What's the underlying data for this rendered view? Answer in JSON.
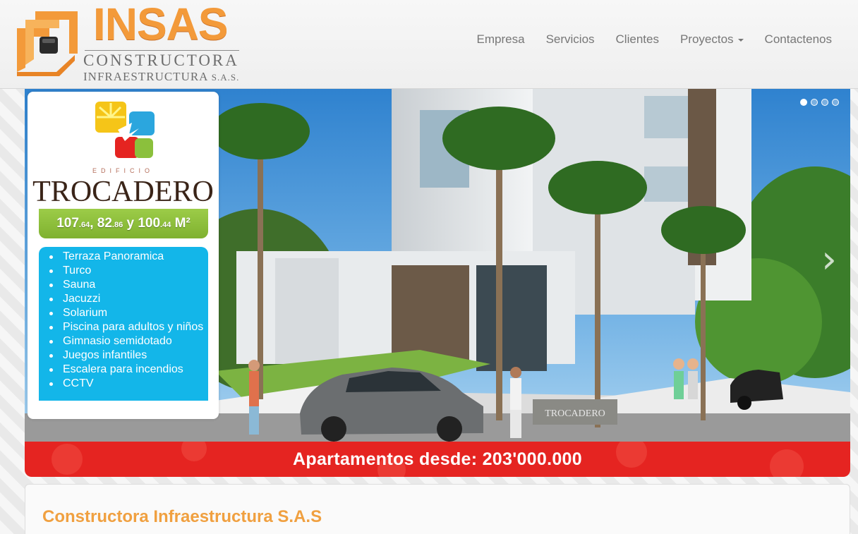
{
  "brand": {
    "name": "INSAS",
    "line1": "CONSTRUCTORA",
    "line2": "INFRAESTRUCTURA",
    "line2_suffix": "S.A.S."
  },
  "nav": {
    "items": [
      {
        "label": "Empresa"
      },
      {
        "label": "Servicios"
      },
      {
        "label": "Clientes"
      },
      {
        "label": "Proyectos",
        "has_dropdown": true
      },
      {
        "label": "Contactenos"
      }
    ]
  },
  "carousel": {
    "indicator_count": 4,
    "active_indicator": 0,
    "next_icon": "chevron-right-icon",
    "card": {
      "eyebrow": "EDIFICIO",
      "title": "TROCADERO",
      "size": {
        "a_whole": "107",
        "a_dec": ".64",
        "sep1": ", ",
        "b_whole": "82",
        "b_dec": ".86",
        "sep2": " y ",
        "c_whole": "100",
        "c_dec": ".44",
        "unit": " M²"
      },
      "amenities": [
        "Terraza Panoramica",
        "Turco",
        "Sauna",
        "Jacuzzi",
        "Solarium",
        "Piscina para adultos y niños",
        "Gimnasio semidotado",
        "Juegos infantiles",
        "Escalera para incendios",
        "CCTV"
      ],
      "colors": {
        "green": "#8bc03c",
        "blue": "#13b6e9",
        "title": "#3a2418"
      }
    },
    "price_text": "Apartamentos desde: 203'000.000",
    "building_sign": "TROCADERO",
    "colors": {
      "price_bar": "#e52421"
    }
  },
  "content": {
    "title": "Constructora Infraestructura S.A.S",
    "colors": {
      "title": "#f0a040"
    }
  },
  "colors": {
    "brand_orange": "#f39a3a",
    "nav_text": "#777777"
  }
}
